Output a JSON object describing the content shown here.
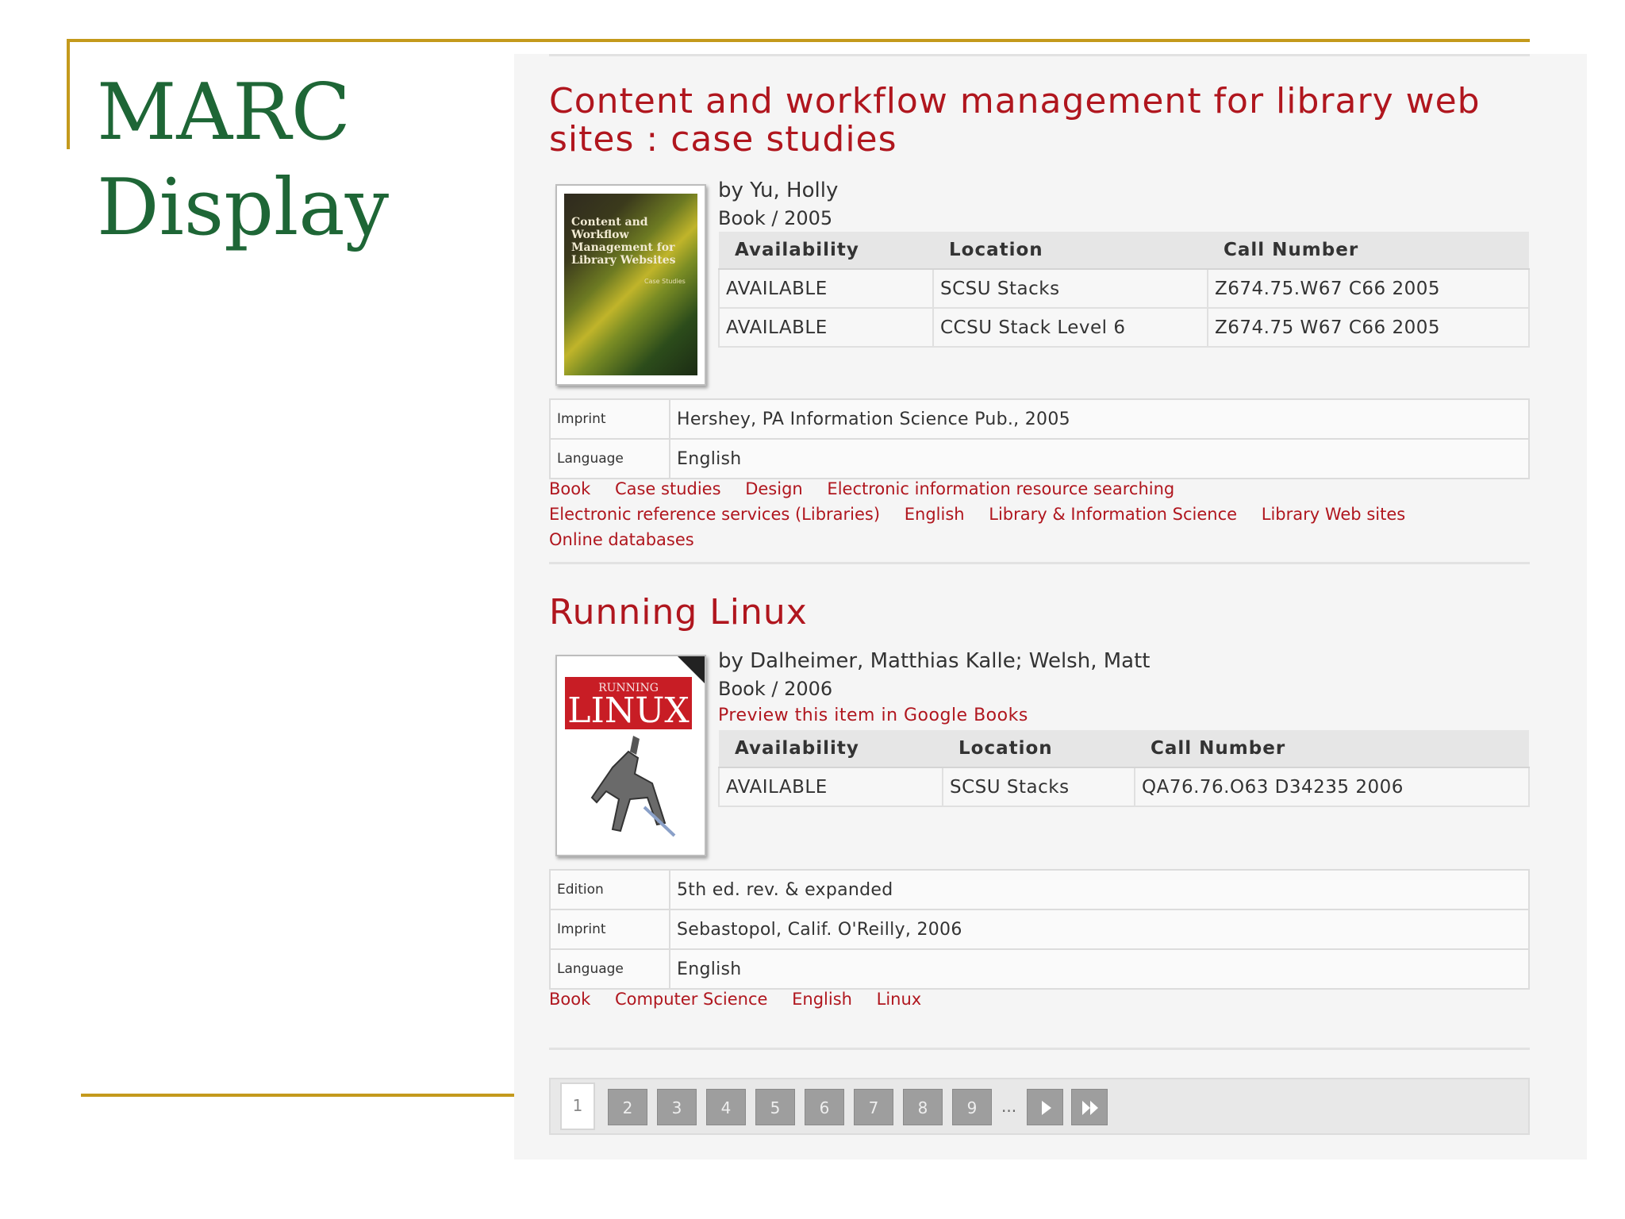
{
  "slide": {
    "title_line1": "MARC",
    "title_line2": "Display"
  },
  "records": [
    {
      "title": "Content and workflow management for library web sites : case studies",
      "author": "by Yu, Holly",
      "format_year": "Book / 2005",
      "cover_text": "Content and Workflow Management for Library Websites",
      "cover_subtitle": "Case Studies",
      "availability_headers": [
        "Availability",
        "Location",
        "Call Number"
      ],
      "holdings": [
        {
          "availability": "AVAILABLE",
          "location": "SCSU Stacks",
          "call_number": "Z674.75.W67 C66 2005"
        },
        {
          "availability": "AVAILABLE",
          "location": "CCSU Stack Level 6",
          "call_number": "Z674.75 W67 C66 2005"
        }
      ],
      "fields": [
        {
          "label": "Imprint",
          "value": "Hershey, PA Information Science Pub., 2005"
        },
        {
          "label": "Language",
          "value": "English"
        }
      ],
      "subjects": [
        "Book",
        "Case studies",
        "Design",
        "Electronic information resource searching",
        "Electronic reference services (Libraries)",
        "English",
        "Library & Information Science",
        "Library Web sites",
        "Online databases"
      ]
    },
    {
      "title": "Running Linux",
      "author": "by Dalheimer, Matthias Kalle; Welsh, Matt",
      "format_year": "Book / 2006",
      "google_books_link": "Preview this item in Google Books",
      "cover_text_small": "RUNNING",
      "cover_text_big": "LINUX",
      "availability_headers": [
        "Availability",
        "Location",
        "Call Number"
      ],
      "holdings": [
        {
          "availability": "AVAILABLE",
          "location": "SCSU Stacks",
          "call_number": "QA76.76.O63 D34235 2006"
        }
      ],
      "fields": [
        {
          "label": "Edition",
          "value": "5th ed. rev. & expanded"
        },
        {
          "label": "Imprint",
          "value": "Sebastopol, Calif. O'Reilly, 2006"
        },
        {
          "label": "Language",
          "value": "English"
        }
      ],
      "subjects": [
        "Book",
        "Computer Science",
        "English",
        "Linux"
      ]
    }
  ],
  "pagination": {
    "current": "1",
    "pages": [
      "2",
      "3",
      "4",
      "5",
      "6",
      "7",
      "8",
      "9"
    ],
    "ellipsis": "..."
  },
  "colors": {
    "title_green": "#1e6636",
    "rule_gold": "#c49a1c",
    "link_red": "#b0161e"
  }
}
